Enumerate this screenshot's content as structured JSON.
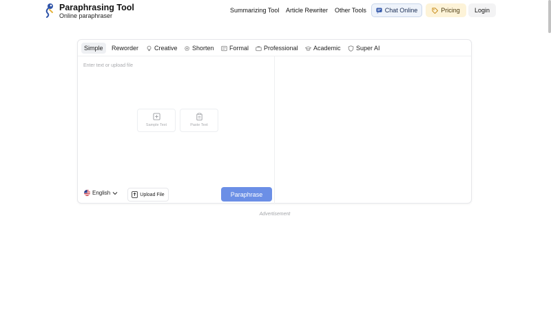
{
  "brand": {
    "title": "Paraphrasing Tool",
    "subtitle": "Online paraphraser"
  },
  "nav": {
    "summarizing": "Summarizing Tool",
    "rewriter": "Article Rewriter",
    "other": "Other Tools",
    "chat": "Chat Online",
    "pricing": "Pricing",
    "login": "Login"
  },
  "tabs": [
    {
      "label": "Simple",
      "icon": "none",
      "active": true
    },
    {
      "label": "Reworder",
      "icon": "none"
    },
    {
      "label": "Creative",
      "icon": "lightbulb-icon"
    },
    {
      "label": "Shorten",
      "icon": "gear-icon"
    },
    {
      "label": "Formal",
      "icon": "document-icon"
    },
    {
      "label": "Professional",
      "icon": "briefcase-icon"
    },
    {
      "label": "Academic",
      "icon": "graduation-icon"
    },
    {
      "label": "Super AI",
      "icon": "shield-icon"
    }
  ],
  "editor": {
    "placeholder": "Enter text or upload file",
    "sample": "Sample Text",
    "paste": "Paste Text"
  },
  "bottom": {
    "language": "English",
    "upload": "Upload File",
    "paraphrase": "Paraphrase"
  },
  "ad": "Advertisement",
  "colors": {
    "primary": "#6b8fe6",
    "pricing_bg": "#fdf3d8",
    "chat_bg": "#eef3fb"
  }
}
